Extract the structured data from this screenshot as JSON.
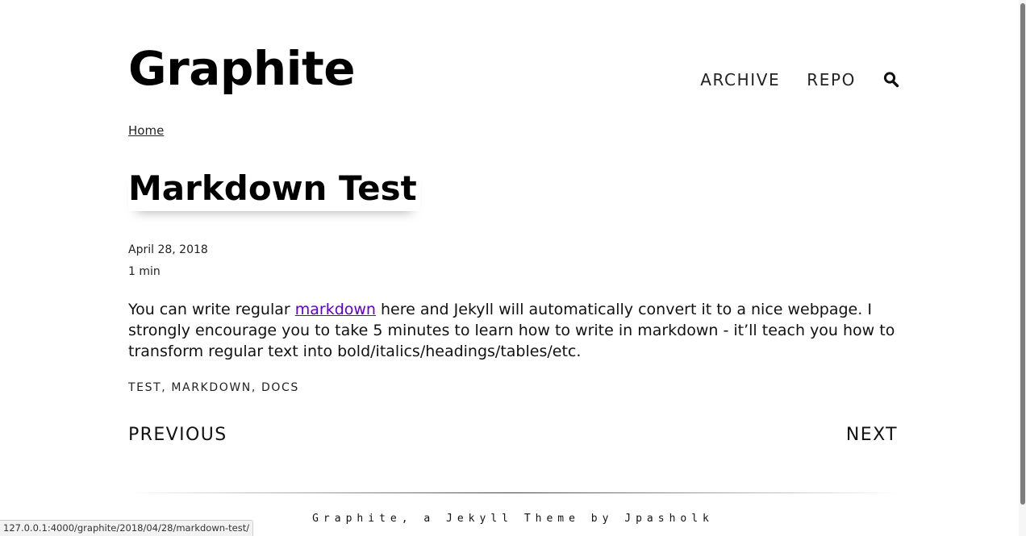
{
  "site": {
    "title": "Graphite"
  },
  "nav": {
    "archive_label": "ARCHIVE",
    "repo_label": "REPO",
    "search_icon": "search-icon"
  },
  "breadcrumb": {
    "home_label": "Home"
  },
  "post": {
    "title": "Markdown Test",
    "date": "April 28, 2018",
    "read_time": "1 min",
    "body_before_link": "You can write regular ",
    "body_link_text": "markdown",
    "body_after_link": " here and Jekyll will automatically convert it to a nice webpage. I strongly encourage you to take 5 minutes to learn how to write in markdown - it’ll teach you how to transform regular text into bold/italics/headings/tables/etc.",
    "tags": [
      "TEST",
      "MARKDOWN",
      "DOCS"
    ],
    "tag_separator": ", "
  },
  "pager": {
    "previous_label": "PREVIOUS",
    "next_label": "NEXT"
  },
  "footer": {
    "text": "Graphite, a Jekyll Theme by Jpasholk"
  },
  "status_bar": {
    "url": "127.0.0.1:4000/graphite/2018/04/28/markdown-test/"
  },
  "colors": {
    "link": "#5b00c8",
    "text": "#111111",
    "background": "#ffffff"
  }
}
